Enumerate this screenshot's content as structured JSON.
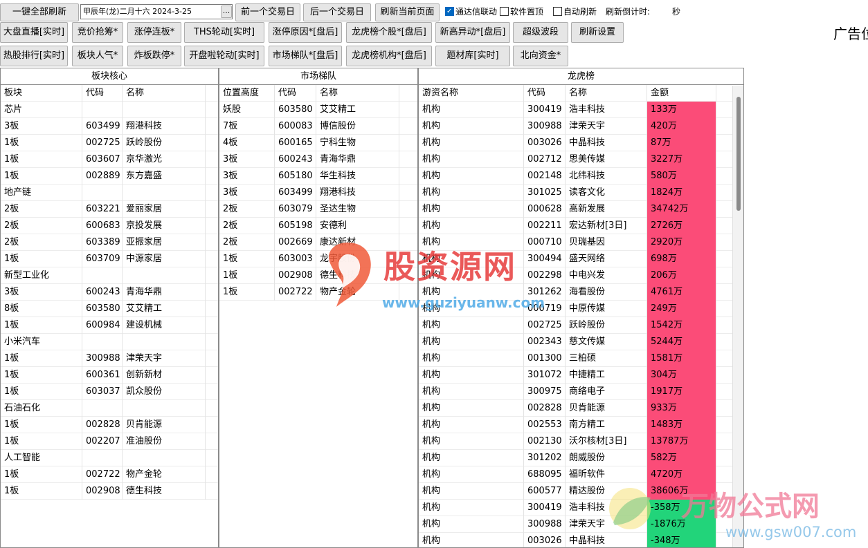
{
  "toolbar": {
    "refresh_all": "一键全部刷新",
    "date_value": "甲辰年(龙)二月十六  2024-3-25",
    "date_picker": "...",
    "prev_day": "前一个交易日",
    "next_day": "后一个交易日",
    "refresh_page": "刷新当前页面",
    "tdx_link": "通达信联动",
    "tdx_link_checked": true,
    "pin_top": "软件置顶",
    "pin_top_checked": false,
    "auto_refresh": "自动刷新",
    "auto_refresh_checked": false,
    "countdown_label": "刷新倒计时:",
    "countdown_unit": "秒"
  },
  "ad_text": "广告位",
  "nav_row1": [
    "大盘直播[实时]",
    "竞价抢筹*",
    "涨停连板*",
    "THS轮动[实时]",
    "涨停原因*[盘后]",
    "龙虎榜个股*[盘后]",
    "新高异动*[盘后]",
    "超级波段",
    "刷新设置"
  ],
  "nav_row2": [
    "热股排行[实时]",
    "板块人气*",
    "炸板跌停*",
    "开盘啦轮动[实时]",
    "市场梯队*[盘后]",
    "龙虎榜机构*[盘后]",
    "题材库[实时]",
    "北向资金*"
  ],
  "sector_panel": {
    "title": "板块核心",
    "headers": [
      "板块",
      "代码",
      "名称"
    ],
    "rows": [
      [
        "芯片",
        "",
        ""
      ],
      [
        "3板",
        "603499",
        "翔港科技"
      ],
      [
        "1板",
        "002725",
        "跃岭股份"
      ],
      [
        "1板",
        "603607",
        "京华激光"
      ],
      [
        "1板",
        "002889",
        "东方嘉盛"
      ],
      [
        "地产链",
        "",
        ""
      ],
      [
        "2板",
        "603221",
        "爱丽家居"
      ],
      [
        "2板",
        "600683",
        "京投发展"
      ],
      [
        "2板",
        "603389",
        "亚振家居"
      ],
      [
        "1板",
        "603709",
        "中源家居"
      ],
      [
        "新型工业化",
        "",
        ""
      ],
      [
        "3板",
        "600243",
        "青海华鼎"
      ],
      [
        "8板",
        "603580",
        "艾艾精工"
      ],
      [
        "1板",
        "600984",
        "建设机械"
      ],
      [
        "小米汽车",
        "",
        ""
      ],
      [
        "1板",
        "300988",
        "津荣天宇"
      ],
      [
        "1板",
        "600361",
        "创新新材"
      ],
      [
        "1板",
        "603037",
        "凯众股份"
      ],
      [
        "石油石化",
        "",
        ""
      ],
      [
        "1板",
        "002828",
        "贝肯能源"
      ],
      [
        "1板",
        "002207",
        "准油股份"
      ],
      [
        "人工智能",
        "",
        ""
      ],
      [
        "1板",
        "002722",
        "物产金轮"
      ],
      [
        "1板",
        "002908",
        "德生科技"
      ]
    ]
  },
  "ladder_panel": {
    "title": "市场梯队",
    "headers": [
      "位置高度",
      "代码",
      "名称"
    ],
    "rows": [
      [
        "妖股",
        "603580",
        "艾艾精工"
      ],
      [
        "7板",
        "600083",
        "博信股份"
      ],
      [
        "4板",
        "600165",
        "宁科生物"
      ],
      [
        "3板",
        "600243",
        "青海华鼎"
      ],
      [
        "3板",
        "605180",
        "华生科技"
      ],
      [
        "3板",
        "603499",
        "翔港科技"
      ],
      [
        "2板",
        "603079",
        "圣达生物"
      ],
      [
        "2板",
        "605198",
        "安德利"
      ],
      [
        "2板",
        "002669",
        "康达新材"
      ],
      [
        "1板",
        "603003",
        "龙宇股份"
      ],
      [
        "1板",
        "002908",
        "德生科技"
      ],
      [
        "1板",
        "002722",
        "物产金轮"
      ]
    ]
  },
  "lhb_panel": {
    "title": "龙虎榜",
    "headers": [
      "游资名称",
      "代码",
      "名称",
      "金额"
    ],
    "rows": [
      [
        "机构",
        "300419",
        "浩丰科技",
        "133万",
        "pos"
      ],
      [
        "机构",
        "300988",
        "津荣天宇",
        "420万",
        "pos"
      ],
      [
        "机构",
        "003026",
        "中晶科技",
        "87万",
        "pos"
      ],
      [
        "机构",
        "002712",
        "思美传媒",
        "3227万",
        "pos"
      ],
      [
        "机构",
        "002148",
        "北纬科技",
        "580万",
        "pos"
      ],
      [
        "机构",
        "301025",
        "读客文化",
        "1824万",
        "pos"
      ],
      [
        "机构",
        "000628",
        "高新发展",
        "34742万",
        "pos"
      ],
      [
        "机构",
        "002211",
        "宏达新材[3日]",
        "2726万",
        "pos"
      ],
      [
        "机构",
        "000710",
        "贝瑞基因",
        "2920万",
        "pos"
      ],
      [
        "机构",
        "300494",
        "盛天网络",
        "698万",
        "pos"
      ],
      [
        "机构",
        "002298",
        "中电兴发",
        "206万",
        "pos"
      ],
      [
        "机构",
        "301262",
        "海看股份",
        "4761万",
        "pos"
      ],
      [
        "机构",
        "000719",
        "中原传媒",
        "249万",
        "pos"
      ],
      [
        "机构",
        "002725",
        "跃岭股份",
        "1542万",
        "pos"
      ],
      [
        "机构",
        "002343",
        "慈文传媒",
        "5244万",
        "pos"
      ],
      [
        "机构",
        "001300",
        "三柏硕",
        "1581万",
        "pos"
      ],
      [
        "机构",
        "301072",
        "中捷精工",
        "304万",
        "pos"
      ],
      [
        "机构",
        "300975",
        "商络电子",
        "1917万",
        "pos"
      ],
      [
        "机构",
        "002828",
        "贝肯能源",
        "933万",
        "pos"
      ],
      [
        "机构",
        "002553",
        "南方精工",
        "1483万",
        "pos"
      ],
      [
        "机构",
        "002130",
        "沃尔核材[3日]",
        "13787万",
        "pos"
      ],
      [
        "机构",
        "301202",
        "朗威股份",
        "582万",
        "pos"
      ],
      [
        "机构",
        "688095",
        "福昕软件",
        "4720万",
        "pos"
      ],
      [
        "机构",
        "600577",
        "精达股份",
        "38606万",
        "pos"
      ],
      [
        "机构",
        "300419",
        "浩丰科技",
        "-358万",
        "neg"
      ],
      [
        "机构",
        "300988",
        "津荣天宇",
        "-1876万",
        "neg"
      ],
      [
        "机构",
        "003026",
        "中晶科技",
        "-348万",
        "neg"
      ]
    ]
  },
  "watermark1": {
    "title": "股资源网",
    "url": "www.guziyuanw.com"
  },
  "watermark2": {
    "title": "万物公式网",
    "url": "www.gsw007.com"
  },
  "colors": {
    "positive_amount": "#fb4c78",
    "negative_amount": "#22d47a",
    "button_bg": "#e6e6e6"
  }
}
